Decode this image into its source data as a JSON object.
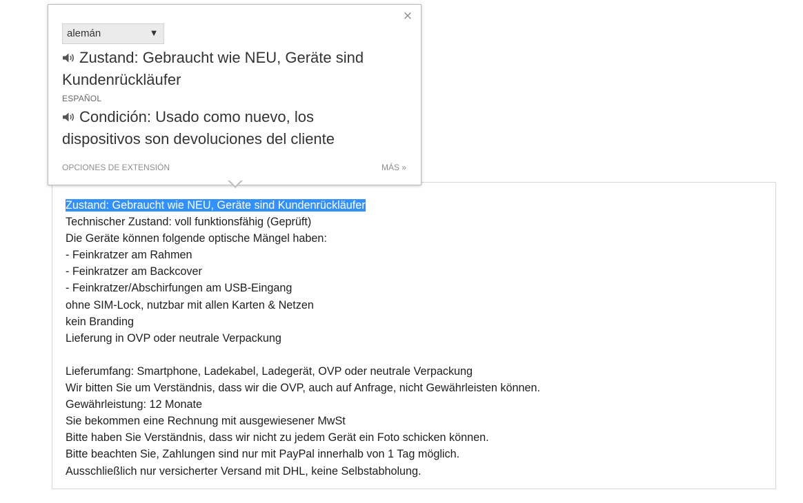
{
  "popup": {
    "close_label": "×",
    "source_language": "alemán",
    "source_text": "Zustand: Gebraucht wie NEU, Geräte sind Kundenrückläufer",
    "target_language": "ESPAÑOL",
    "target_text": "Condición: Usado como nuevo, los dispositivos son devoluciones del cliente",
    "extension_options_label": "OPCIONES DE EXTENSIÓN",
    "more_label": "MÁS »",
    "speaker_icon": "speaker-icon",
    "caret_icon": "chevron-down-icon"
  },
  "description": {
    "selection_color": "#3390ff",
    "lines": [
      "Zustand: Gebraucht wie NEU, Geräte sind Kundenrückläufer",
      "Technischer Zustand: voll funktionsfähig (Geprüft)",
      "Die Geräte können folgende optische Mängel haben:",
      "- Feinkratzer am Rahmen",
      "- Feinkratzer am Backcover",
      "- Feinkratzer/Abschirfungen am USB-Eingang",
      "ohne SIM-Lock, nutzbar mit allen Karten & Netzen",
      "kein Branding",
      "Lieferung in OVP oder neutrale Verpackung",
      "Lieferumfang: Smartphone, Ladekabel, Ladegerät, OVP oder neutrale Verpackung",
      "Wir bitten Sie um Verständnis, dass wir die OVP, auch auf Anfrage, nicht Gewährleisten können.",
      "Gewährleistung: 12 Monate",
      "Sie bekommen eine Rechnung mit ausgewiesener MwSt",
      "Bitte haben Sie Verständnis, dass wir nicht zu jedem Gerät ein Foto schicken können.",
      "Bitte beachten Sie, Zahlungen sind nur mit PayPal innerhalb von 1 Tag möglich.",
      "Ausschließlich nur versicherter Versand mit DHL, keine Selbstabholung."
    ]
  }
}
